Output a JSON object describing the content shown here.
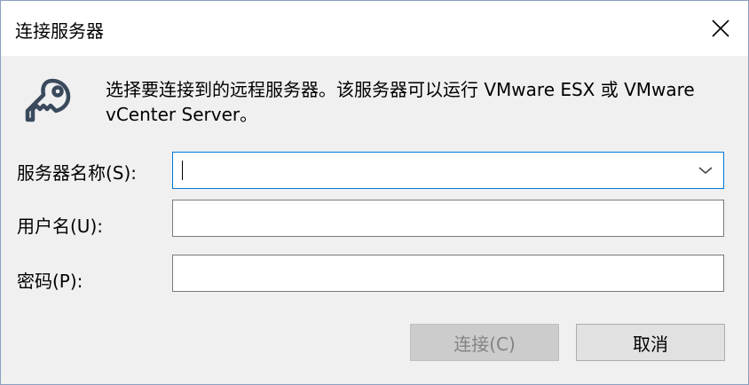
{
  "dialog": {
    "title": "连接服务器",
    "description": "选择要连接到的远程服务器。该服务器可以运行 VMware ESX 或 VMware vCenter Server。"
  },
  "form": {
    "server": {
      "label": "服务器名称(S):",
      "value": ""
    },
    "username": {
      "label": "用户名(U):",
      "value": ""
    },
    "password": {
      "label": "密码(P):",
      "value": ""
    }
  },
  "buttons": {
    "connect": "连接(C)",
    "cancel": "取消"
  },
  "icons": {
    "close": "close-icon",
    "key": "key-icon",
    "dropdown": "chevron-down-icon"
  },
  "colors": {
    "focus_border": "#0078d7",
    "disabled_text": "#838383"
  }
}
